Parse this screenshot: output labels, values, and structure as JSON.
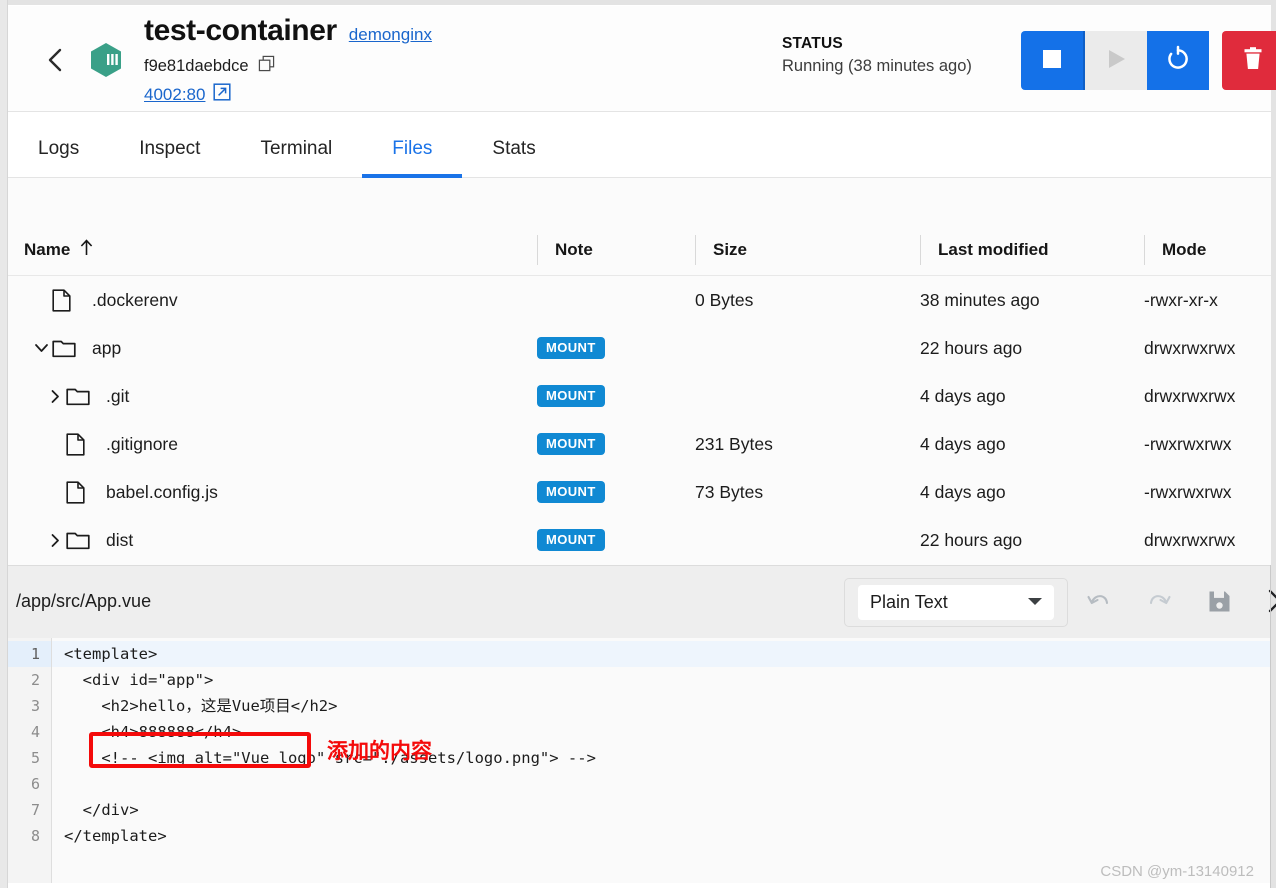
{
  "header": {
    "back_icon": "chevron-left-icon",
    "container_icon": "container-hexagon-icon",
    "title": "test-container",
    "image_link": "demonginx",
    "container_id": "f9e81daebdce",
    "copy_icon": "copy-icon",
    "port_link": "4002:80",
    "external_link_icon": "external-link-icon",
    "status_label": "STATUS",
    "status_value": "Running (38 minutes ago)",
    "actions": [
      {
        "name": "stop-button",
        "icon": "stop-square-icon",
        "style": "blue",
        "enabled": true
      },
      {
        "name": "start-button",
        "icon": "play-triangle-icon",
        "style": "disabled",
        "enabled": false
      },
      {
        "name": "restart-button",
        "icon": "restart-circular-arrow-icon",
        "style": "blue",
        "enabled": true
      },
      {
        "name": "delete-button",
        "icon": "trash-icon",
        "style": "red",
        "enabled": true
      }
    ],
    "colors": {
      "blue": "#1471e8",
      "red": "#e02b3c",
      "disabled": "#ebebeb",
      "link": "#1a66cc",
      "container_icon": "#3aa088"
    }
  },
  "tabs": {
    "items": [
      {
        "label": "Logs",
        "active": false
      },
      {
        "label": "Inspect",
        "active": false
      },
      {
        "label": "Terminal",
        "active": false
      },
      {
        "label": "Files",
        "active": true
      },
      {
        "label": "Stats",
        "active": false
      }
    ],
    "active_color": "#1a73e8"
  },
  "file_table": {
    "columns": [
      {
        "label": "Name",
        "sort_icon": "arrow-up-icon"
      },
      {
        "label": "Note"
      },
      {
        "label": "Size"
      },
      {
        "label": "Last modified"
      },
      {
        "label": "Mode"
      }
    ],
    "badge_label": "MOUNT",
    "badge_color": "#1089d3",
    "rows": [
      {
        "name": ".dockerenv",
        "type": "file",
        "depth": 0,
        "twisty": "",
        "note": "",
        "size": "0 Bytes",
        "modified": "38 minutes ago",
        "mode": "-rwxr-xr-x"
      },
      {
        "name": "app",
        "type": "folder",
        "depth": 0,
        "twisty": "expanded",
        "note": "MOUNT",
        "size": "",
        "modified": "22 hours ago",
        "mode": "drwxrwxrwx"
      },
      {
        "name": ".git",
        "type": "folder",
        "depth": 1,
        "twisty": "collapsed",
        "note": "MOUNT",
        "size": "",
        "modified": "4 days ago",
        "mode": "drwxrwxrwx"
      },
      {
        "name": ".gitignore",
        "type": "file",
        "depth": 1,
        "twisty": "",
        "note": "MOUNT",
        "size": "231 Bytes",
        "modified": "4 days ago",
        "mode": "-rwxrwxrwx"
      },
      {
        "name": "babel.config.js",
        "type": "file",
        "depth": 1,
        "twisty": "",
        "note": "MOUNT",
        "size": "73 Bytes",
        "modified": "4 days ago",
        "mode": "-rwxrwxrwx"
      },
      {
        "name": "dist",
        "type": "folder",
        "depth": 1,
        "twisty": "collapsed",
        "note": "MOUNT",
        "size": "",
        "modified": "22 hours ago",
        "mode": "drwxrwxrwx"
      }
    ]
  },
  "editor": {
    "path": "/app/src/App.vue",
    "language": "Plain Text",
    "language_options": [
      "Plain Text"
    ],
    "dropdown_icon": "chevron-down-icon",
    "tools": [
      {
        "name": "undo-button",
        "icon": "undo-arrow-icon"
      },
      {
        "name": "redo-button",
        "icon": "redo-arrow-icon"
      },
      {
        "name": "save-button",
        "icon": "floppy-disk-icon"
      },
      {
        "name": "close-button",
        "icon": "close-x-icon"
      }
    ],
    "active_line": 1,
    "lines": [
      {
        "n": "1",
        "text": "<template>"
      },
      {
        "n": "2",
        "text": "  <div id=\"app\">"
      },
      {
        "n": "3",
        "text": "    <h2>hello，这是Vue项目</h2>"
      },
      {
        "n": "4",
        "text": "    <h4>888888</h4>"
      },
      {
        "n": "5",
        "text": "    <!-- <img alt=\"Vue logo\" src=\"./assets/logo.png\"> -->"
      },
      {
        "n": "6",
        "text": ""
      },
      {
        "n": "7",
        "text": "  </div>"
      },
      {
        "n": "8",
        "text": "</template>"
      }
    ]
  },
  "annotation": {
    "text": "添加的内容",
    "color": "#f40a0a"
  },
  "watermark": "CSDN @ym-13140912"
}
